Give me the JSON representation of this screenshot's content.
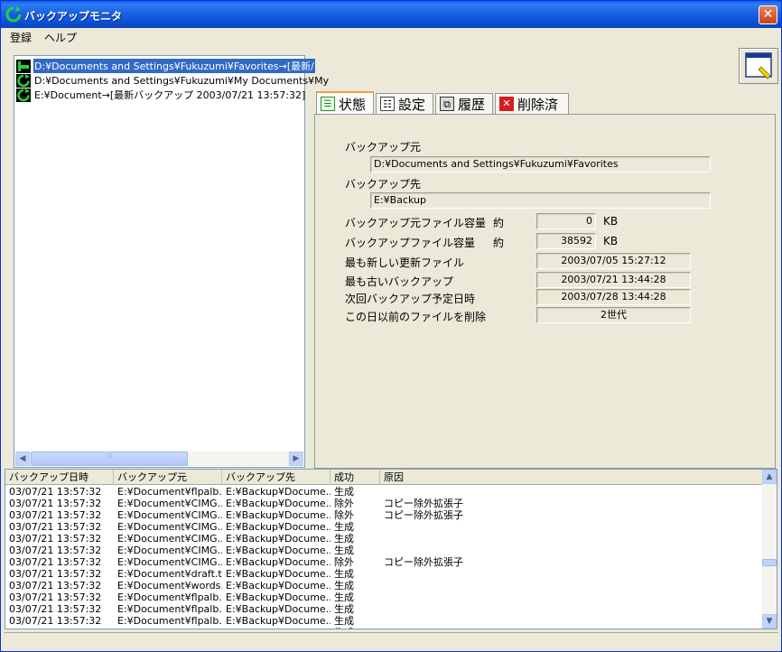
{
  "window": {
    "title": "バックアップモニタ",
    "close_glyph": "✕"
  },
  "menu": {
    "items": [
      "登録",
      "ヘルプ"
    ]
  },
  "tree": {
    "items": [
      {
        "label": "D:¥Documents and Settings¥Fukuzumi¥Favorites→[最新/",
        "selected": true
      },
      {
        "label": "D:¥Documents and Settings¥Fukuzumi¥My Documents¥My",
        "selected": false
      },
      {
        "label": "E:¥Document→[最新バックアップ 2003/07/21 13:57:32]",
        "selected": false
      }
    ]
  },
  "tabs": [
    {
      "label": "状態",
      "icon": "list-status-icon",
      "active": true
    },
    {
      "label": "設定",
      "icon": "settings-sheet-icon",
      "active": false
    },
    {
      "label": "履歴",
      "icon": "history-icon",
      "active": false
    },
    {
      "label": "削除済",
      "icon": "delete-icon",
      "active": false
    }
  ],
  "status": {
    "source_label": "バックアップ元",
    "source_value": "D:¥Documents and Settings¥Fukuzumi¥Favorites",
    "dest_label": "バックアップ先",
    "dest_value": "E:¥Backup",
    "source_size_label": "バックアップ元ファイル容量",
    "source_size_prefix": "約",
    "source_size_value": "0",
    "source_size_unit": "KB",
    "backup_size_label": "バックアップファイル容量",
    "backup_size_prefix": "約",
    "backup_size_value": "38592",
    "backup_size_unit": "KB",
    "newest_label": "最も新しい更新ファイル",
    "newest_value": "2003/07/05 15:27:12",
    "oldest_label": "最も古いバックアップ",
    "oldest_value": "2003/07/21 13:44:28",
    "next_label": "次回バックアップ予定日時",
    "next_value": "2003/07/28 13:44:28",
    "delete_label": "この日以前のファイルを削除",
    "delete_value": "2世代"
  },
  "log": {
    "columns": [
      "バックアップ日時",
      "バックアップ元",
      "バックアップ先",
      "成功",
      "原因"
    ],
    "rows": [
      [
        "03/07/21 13:57:32",
        "E:¥Document¥flpalb...",
        "E:¥Backup¥Docume...",
        "生成",
        ""
      ],
      [
        "03/07/21 13:57:32",
        "E:¥Document¥CIMG...",
        "E:¥Backup¥Docume...",
        "除外",
        "コピー除外拡張子"
      ],
      [
        "03/07/21 13:57:32",
        "E:¥Document¥CIMG...",
        "E:¥Backup¥Docume...",
        "除外",
        "コピー除外拡張子"
      ],
      [
        "03/07/21 13:57:32",
        "E:¥Document¥CIMG...",
        "E:¥Backup¥Docume...",
        "生成",
        ""
      ],
      [
        "03/07/21 13:57:32",
        "E:¥Document¥CIMG...",
        "E:¥Backup¥Docume...",
        "生成",
        ""
      ],
      [
        "03/07/21 13:57:32",
        "E:¥Document¥CIMG...",
        "E:¥Backup¥Docume...",
        "生成",
        ""
      ],
      [
        "03/07/21 13:57:32",
        "E:¥Document¥CIMG...",
        "E:¥Backup¥Docume...",
        "除外",
        "コピー除外拡張子"
      ],
      [
        "03/07/21 13:57:32",
        "E:¥Document¥draft.t...",
        "E:¥Backup¥Docume...",
        "生成",
        ""
      ],
      [
        "03/07/21 13:57:32",
        "E:¥Document¥words...",
        "E:¥Backup¥Docume...",
        "生成",
        ""
      ],
      [
        "03/07/21 13:57:32",
        "E:¥Document¥flpalb...",
        "E:¥Backup¥Docume...",
        "生成",
        ""
      ],
      [
        "03/07/21 13:57:32",
        "E:¥Document¥flpalb...",
        "E:¥Backup¥Docume...",
        "生成",
        ""
      ],
      [
        "03/07/21 13:57:32",
        "E:¥Document¥flpalb...",
        "E:¥Backup¥Docume...",
        "生成",
        ""
      ],
      [
        "03/07/21 13:57:32",
        "E:¥Document¥flpalb...",
        "E:¥Backup¥Docume...",
        "生成",
        ""
      ]
    ]
  },
  "colors": {
    "titlebar": "#0a4fd3",
    "selection": "#316ac5",
    "tab_accent": "#f1a036"
  }
}
